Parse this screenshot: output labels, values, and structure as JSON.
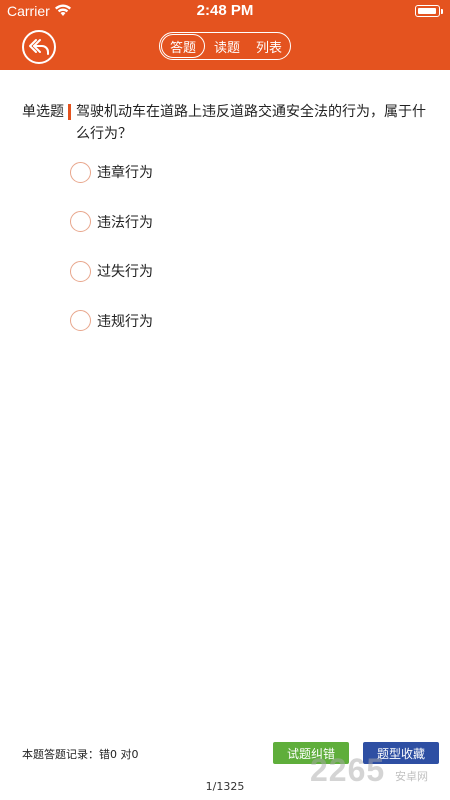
{
  "status_bar": {
    "carrier": "Carrier",
    "time": "2:48 PM"
  },
  "header": {
    "tabs": [
      {
        "label": "答题",
        "active": true
      },
      {
        "label": "读题",
        "active": false
      },
      {
        "label": "列表",
        "active": false
      }
    ]
  },
  "question": {
    "type": "单选题",
    "text": "驾驶机动车在道路上违反道路交通安全法的行为，属于什么行为？",
    "options": [
      {
        "label": "违章行为"
      },
      {
        "label": "违法行为"
      },
      {
        "label": "过失行为"
      },
      {
        "label": "违规行为"
      }
    ]
  },
  "footer": {
    "record": "本题答题记录：错0  对0",
    "correct_button": "试题纠错",
    "favorite_button": "题型收藏",
    "page": "1/1325"
  },
  "watermark": {
    "text": "2265",
    "sub": "安卓网"
  },
  "colors": {
    "accent": "#e4531f",
    "green": "#5fae3b",
    "blue": "#2e4fa3"
  }
}
